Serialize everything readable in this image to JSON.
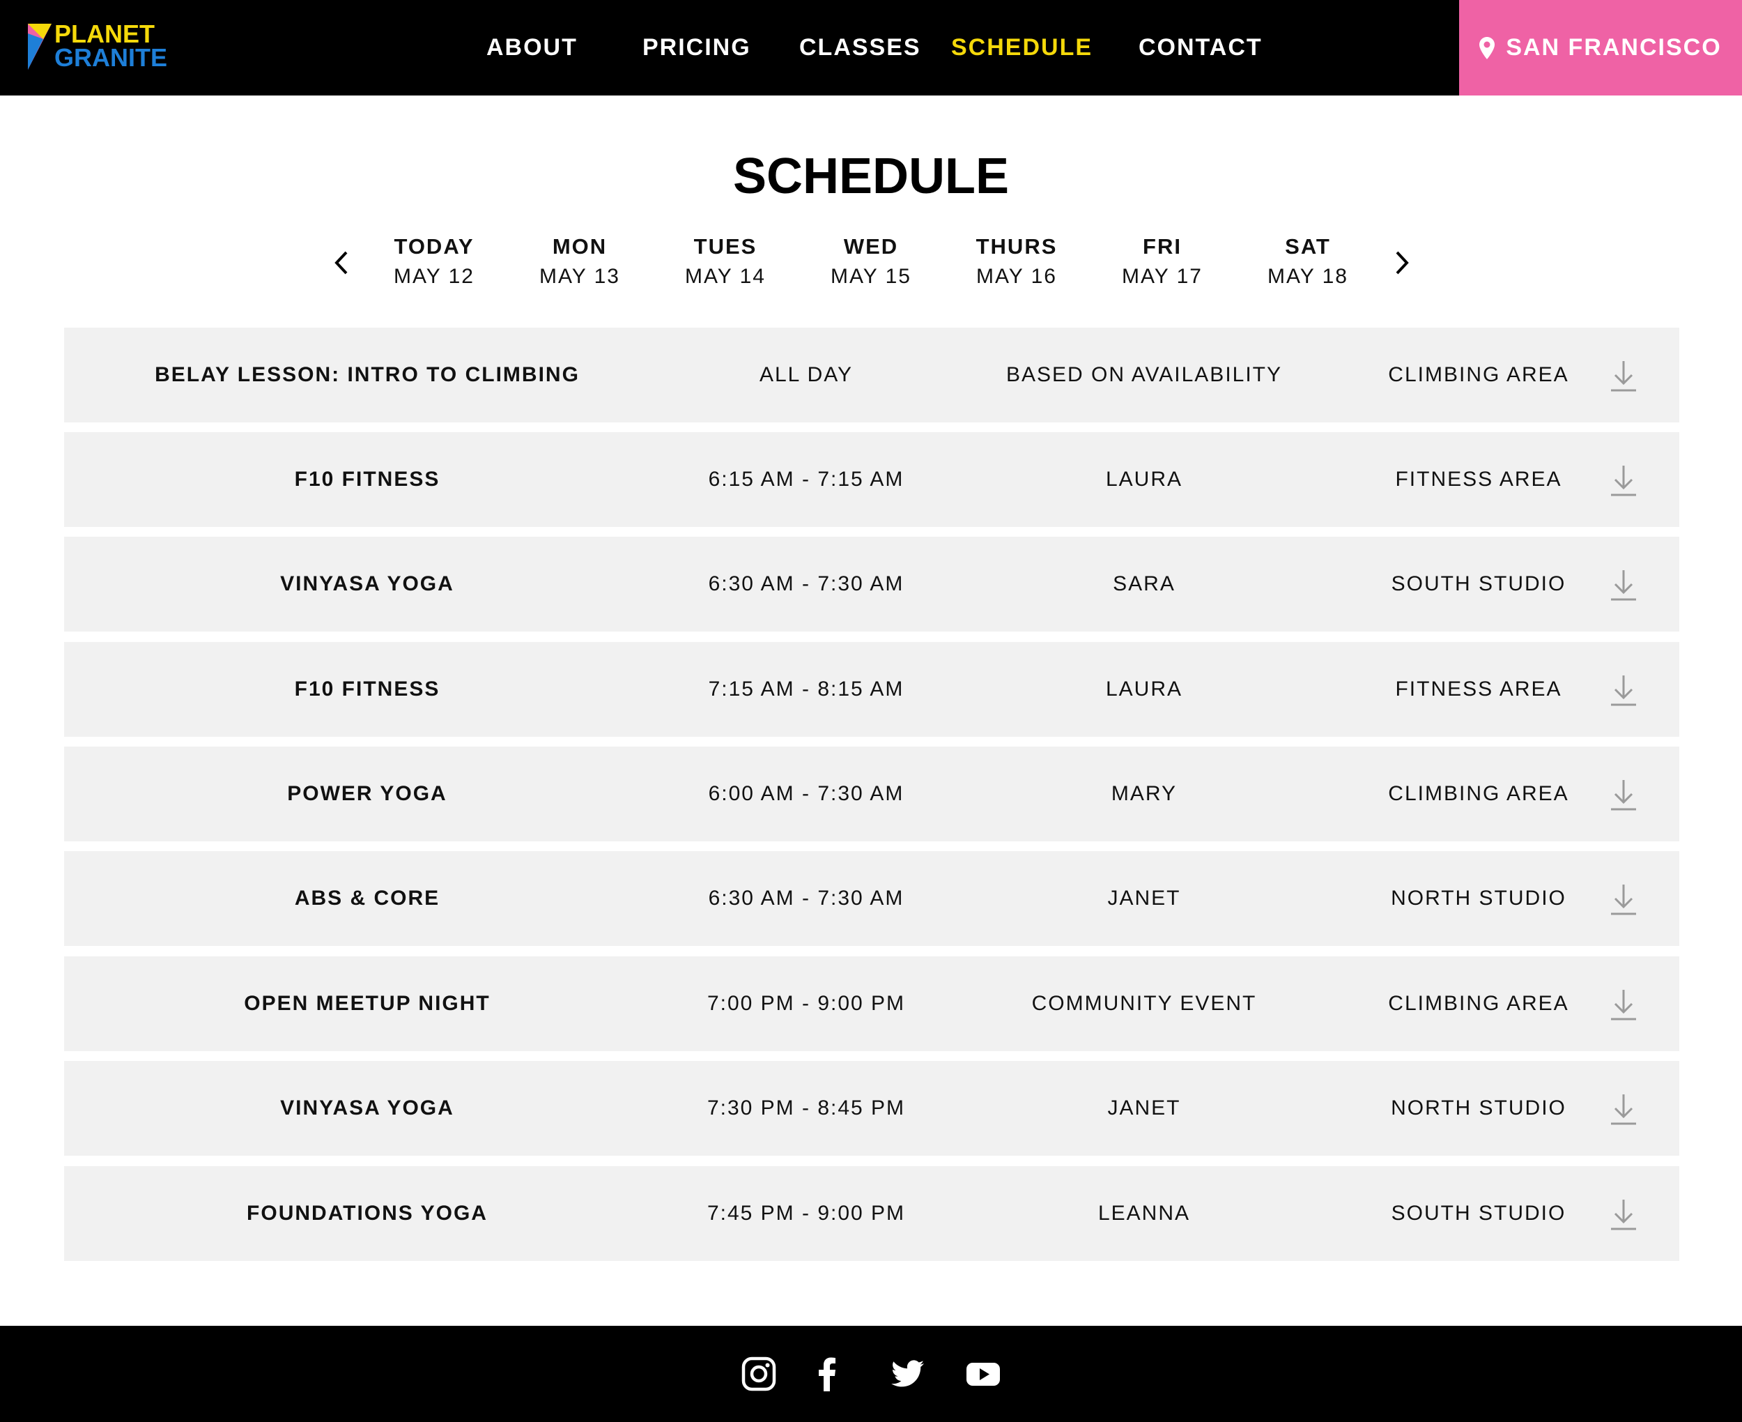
{
  "brand": {
    "line1": "PLANET",
    "line2": "GRANITE",
    "colors": {
      "yellow": "#f5d90a",
      "blue": "#1e7fd8",
      "pink": "#ef62a5",
      "black": "#000000"
    }
  },
  "nav": {
    "items": [
      {
        "label": "ABOUT",
        "active": false
      },
      {
        "label": "PRICING",
        "active": false
      },
      {
        "label": "CLASSES",
        "active": false
      },
      {
        "label": "SCHEDULE",
        "active": true
      },
      {
        "label": "CONTACT",
        "active": false
      }
    ],
    "active_color": "#f5d90a",
    "location": {
      "label": "SAN FRANCISCO",
      "icon": "map-pin-icon",
      "background": "#ef62a5"
    }
  },
  "page": {
    "title": "SCHEDULE"
  },
  "days": {
    "prev_icon": "chevron-left-icon",
    "next_icon": "chevron-right-icon",
    "items": [
      {
        "name": "TODAY",
        "date": "MAY 12"
      },
      {
        "name": "MON",
        "date": "MAY 13"
      },
      {
        "name": "TUES",
        "date": "MAY 14"
      },
      {
        "name": "WED",
        "date": "MAY 15"
      },
      {
        "name": "THURS",
        "date": "MAY 16"
      },
      {
        "name": "FRI",
        "date": "MAY 17"
      },
      {
        "name": "SAT",
        "date": "MAY 18"
      }
    ]
  },
  "schedule": {
    "download_icon": "download-icon",
    "rows": [
      {
        "name": "BELAY LESSON: INTRO TO CLIMBING",
        "time": "ALL DAY",
        "instructor": "BASED ON AVAILABILITY",
        "location": "CLIMBING AREA"
      },
      {
        "name": "F10 FITNESS",
        "time": "6:15 AM - 7:15 AM",
        "instructor": "LAURA",
        "location": "FITNESS AREA"
      },
      {
        "name": "VINYASA YOGA",
        "time": "6:30 AM - 7:30 AM",
        "instructor": "SARA",
        "location": "SOUTH STUDIO"
      },
      {
        "name": "F10 FITNESS",
        "time": "7:15 AM - 8:15 AM",
        "instructor": "LAURA",
        "location": "FITNESS AREA"
      },
      {
        "name": "POWER YOGA",
        "time": "6:00 AM - 7:30 AM",
        "instructor": "MARY",
        "location": "CLIMBING AREA"
      },
      {
        "name": "ABS & CORE",
        "time": "6:30 AM - 7:30 AM",
        "instructor": "JANET",
        "location": "NORTH STUDIO"
      },
      {
        "name": "OPEN MEETUP NIGHT",
        "time": "7:00 PM - 9:00 PM",
        "instructor": "COMMUNITY EVENT",
        "location": "CLIMBING AREA"
      },
      {
        "name": "VINYASA YOGA",
        "time": "7:30 PM - 8:45 PM",
        "instructor": "JANET",
        "location": "NORTH STUDIO"
      },
      {
        "name": "FOUNDATIONS YOGA",
        "time": "7:45 PM - 9:00 PM",
        "instructor": "LEANNA",
        "location": "SOUTH STUDIO"
      }
    ]
  },
  "footer": {
    "social": [
      "instagram-icon",
      "facebook-icon",
      "twitter-icon",
      "youtube-icon"
    ]
  }
}
